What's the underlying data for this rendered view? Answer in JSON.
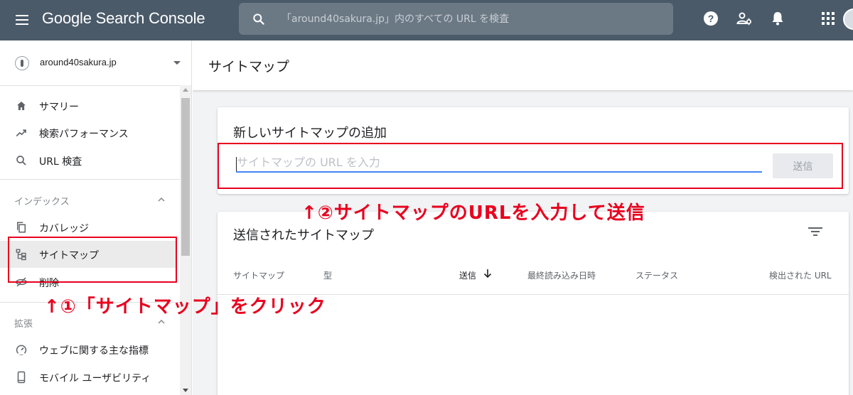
{
  "app": {
    "title": "Google Search Console",
    "search_placeholder": "「around40sakura.jp」内のすべての URL を検査"
  },
  "sidebar": {
    "property": "around40sakura.jp",
    "items": [
      {
        "label": "サマリー",
        "icon": "home-icon"
      },
      {
        "label": "検索パフォーマンス",
        "icon": "trending-up-icon"
      },
      {
        "label": "URL 検査",
        "icon": "search-icon"
      }
    ],
    "index_section": {
      "title": "インデックス",
      "items": [
        {
          "label": "カバレッジ",
          "icon": "copy-icon"
        },
        {
          "label": "サイトマップ",
          "icon": "sitemap-icon",
          "active": true
        },
        {
          "label": "削除",
          "icon": "removals-icon"
        }
      ]
    },
    "enhancements_section": {
      "title": "拡張",
      "items": [
        {
          "label": "ウェブに関する主な指標",
          "icon": "speed-icon"
        },
        {
          "label": "モバイル ユーザビリティ",
          "icon": "phone-icon"
        }
      ]
    }
  },
  "main": {
    "page_title": "サイトマップ",
    "add_card": {
      "title": "新しいサイトマップの追加",
      "input_placeholder": "サイトマップの URL を入力",
      "input_value": "",
      "submit_label": "送信"
    },
    "submitted_card": {
      "title": "送信されたサイトマップ",
      "columns": [
        "サイトマップ",
        "型",
        "送信",
        "最終読み込み日時",
        "ステータス",
        "検出された URL"
      ],
      "sorted_column": "送信"
    }
  },
  "annotations": {
    "step1": "↑①「サイトマップ」をクリック",
    "step2": "↑②サイトマップのURLを入力して送信"
  },
  "colors": {
    "topbar": "#4a5a69",
    "accent": "#4285f4",
    "annotation": "#e8001e"
  }
}
